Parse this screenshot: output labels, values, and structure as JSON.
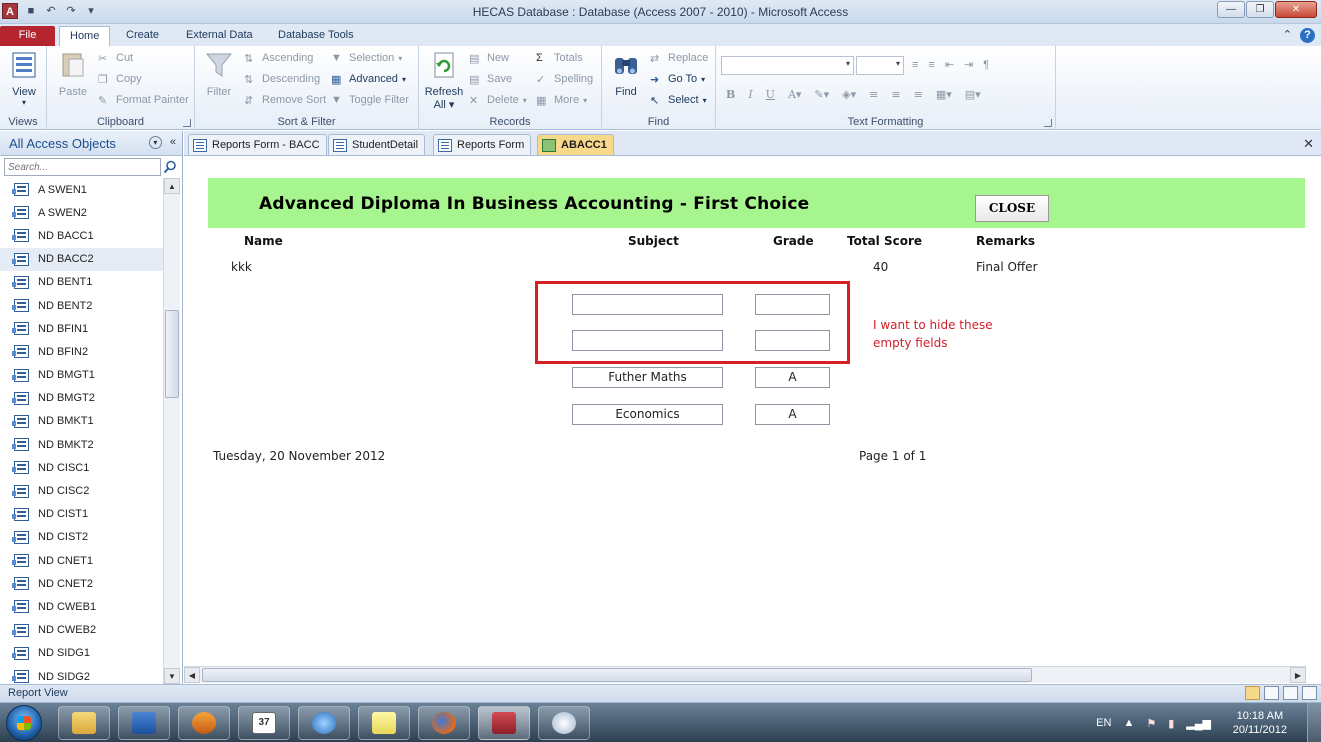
{
  "window": {
    "title": "HECAS Database : Database (Access 2007 - 2010)  -  Microsoft Access"
  },
  "ribbon_tabs": [
    "File",
    "Home",
    "Create",
    "External Data",
    "Database Tools"
  ],
  "ribbon": {
    "views": {
      "view": "View",
      "label": "Views"
    },
    "clipboard": {
      "paste": "Paste",
      "cut": "Cut",
      "copy": "Copy",
      "format_painter": "Format Painter",
      "label": "Clipboard"
    },
    "sort_filter": {
      "filter": "Filter",
      "ascending": "Ascending",
      "descending": "Descending",
      "remove_sort": "Remove Sort",
      "selection": "Selection",
      "advanced": "Advanced",
      "toggle_filter": "Toggle Filter",
      "label": "Sort & Filter"
    },
    "records": {
      "refresh": "Refresh",
      "refresh_all": "All",
      "new": "New",
      "save": "Save",
      "delete": "Delete",
      "totals": "Totals",
      "spelling": "Spelling",
      "more": "More",
      "label": "Records"
    },
    "find": {
      "find": "Find",
      "replace": "Replace",
      "goto": "Go To",
      "select": "Select",
      "label": "Find"
    },
    "text_formatting": {
      "label": "Text Formatting",
      "bold": "B",
      "italic": "I",
      "underline": "U"
    }
  },
  "nav_pane": {
    "title": "All Access Objects",
    "search_placeholder": "Search...",
    "items": [
      "A SWEN1",
      "A SWEN2",
      "ND BACC1",
      "ND BACC2",
      "ND BENT1",
      "ND BENT2",
      "ND BFIN1",
      "ND BFIN2",
      "ND BMGT1",
      "ND BMGT2",
      "ND BMKT1",
      "ND BMKT2",
      "ND CISC1",
      "ND CISC2",
      "ND CIST1",
      "ND CIST2",
      "ND CNET1",
      "ND CNET2",
      "ND CWEB1",
      "ND CWEB2",
      "ND SIDG1",
      "ND SIDG2"
    ],
    "selected_index": 3
  },
  "doc_tabs": [
    "Reports Form - BACC",
    "StudentDetail",
    "Reports Form",
    "ABACC1"
  ],
  "report": {
    "title": "Advanced Diploma In Business Accounting - First Choice",
    "close_label": "CLOSE",
    "headers": {
      "name": "Name",
      "subject": "Subject",
      "grade": "Grade",
      "total_score": "Total Score",
      "remarks": "Remarks"
    },
    "record": {
      "name": "kkk",
      "total_score": "40",
      "remarks": "Final Offer"
    },
    "subjects": [
      {
        "subject": "",
        "grade": ""
      },
      {
        "subject": "",
        "grade": ""
      },
      {
        "subject": "Futher Maths",
        "grade": "A"
      },
      {
        "subject": "Economics",
        "grade": "A"
      }
    ],
    "annotation": "I want to hide these empty fields",
    "date": "Tuesday, 20 November 2012",
    "page": "Page 1 of 1"
  },
  "status_bar": {
    "text": "Report View"
  },
  "taskbar": {
    "language": "EN",
    "time": "10:18 AM",
    "date": "20/11/2012",
    "calendar_badge": "37"
  }
}
